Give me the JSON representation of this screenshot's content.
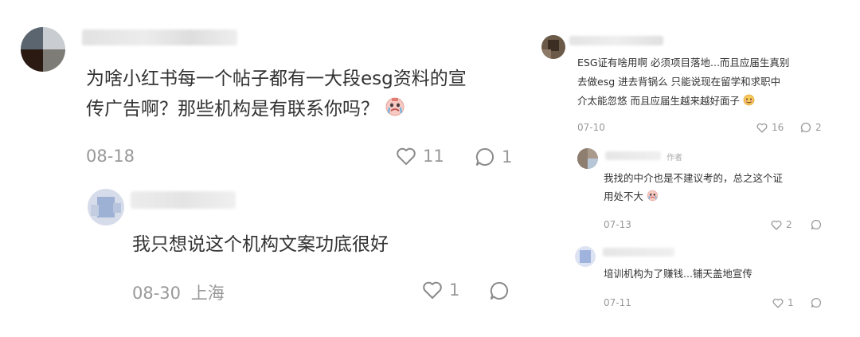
{
  "left": {
    "comment": {
      "text_line1": "为啥小红书每一个帖子都有一大段esg资料的宣",
      "text_line2": "传广告啊？那些机构是有联系你吗？",
      "date": "08-18",
      "likes": "11",
      "replies": "1",
      "emoji_icon": "crying-face-icon"
    },
    "reply": {
      "text": "我只想说这个机构文案功底很好",
      "date": "08-30",
      "location": "上海",
      "likes": "1",
      "replies": ""
    }
  },
  "right": {
    "comment": {
      "text_line1": "ESG证有啥用啊 必须项目落地...而且应届生真别",
      "text_line2": "去做esg 进去背锅么 只能说现在留学和求职中",
      "text_line3": "介太能忽悠 而且应届生越来越好面子",
      "date": "07-10",
      "likes": "16",
      "replies": "2"
    },
    "reply1": {
      "author_tag": "作者",
      "text_line1": "我找的中介也是不建议考的，总之这个证",
      "text_line2": "用处不大",
      "date": "07-13",
      "likes": "2",
      "replies": ""
    },
    "reply2": {
      "text": "培训机构为了赚钱...铺天盖地宣传",
      "date": "07-11",
      "likes": "1",
      "replies": ""
    }
  },
  "colors": {
    "text": "#333333",
    "meta": "#999999",
    "background": "#ffffff"
  }
}
